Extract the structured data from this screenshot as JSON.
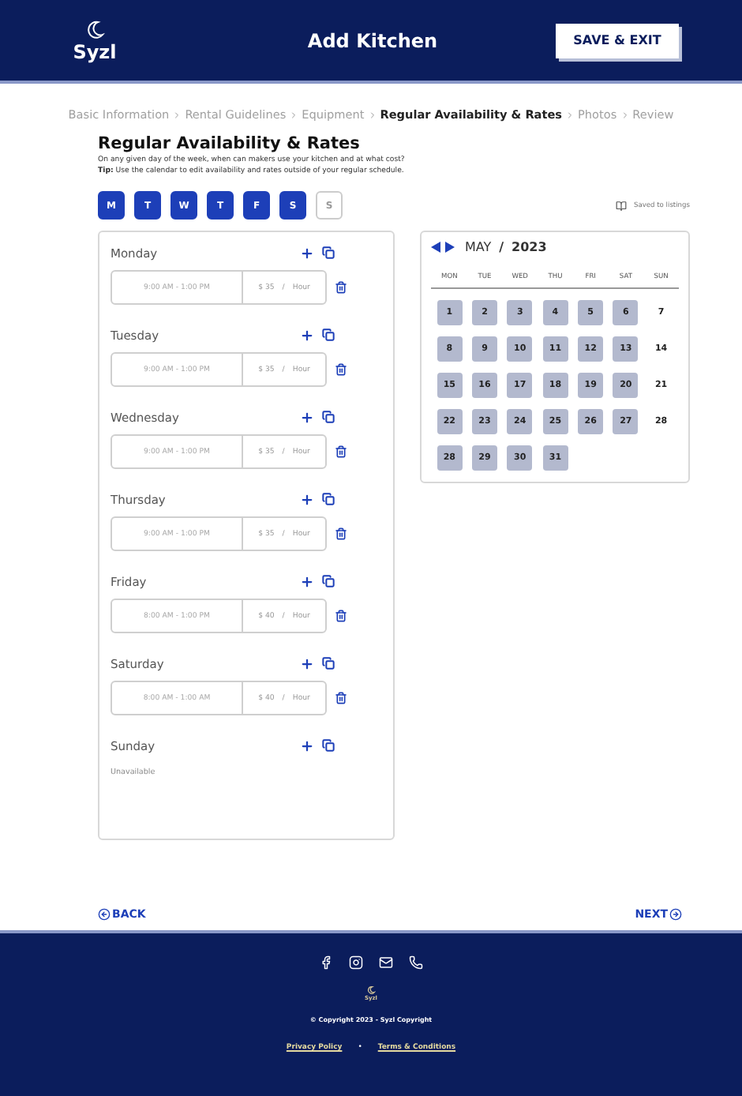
{
  "header": {
    "logo": "Syzl",
    "title": "Add Kitchen",
    "save_button": "SAVE & EXIT"
  },
  "breadcrumb": [
    {
      "label": "Basic Information",
      "selected": false
    },
    {
      "label": "Rental Guidelines",
      "selected": false
    },
    {
      "label": "Equipment",
      "selected": false
    },
    {
      "label": "Regular Availability & Rates",
      "selected": true
    },
    {
      "label": "Photos",
      "selected": false
    },
    {
      "label": "Review",
      "selected": false
    }
  ],
  "heading": "Regular Availability & Rates",
  "intro": "On any given day of the week, when can makers use your kitchen and at what cost?",
  "tip": "**Tip:** Use the calendar to edit availability and rates outside of your regular schedule.",
  "weekday_toggles": [
    {
      "label": "M",
      "selected": true
    },
    {
      "label": "T",
      "selected": true
    },
    {
      "label": "W",
      "selected": true
    },
    {
      "label": "T",
      "selected": true
    },
    {
      "label": "F",
      "selected": true
    },
    {
      "label": "S",
      "selected": true
    },
    {
      "label": "S",
      "selected": false
    }
  ],
  "saved_note": "Saved to listings",
  "schedule": [
    {
      "day": "Monday",
      "slots": [
        {
          "time": "9:00 AM - 1:00 PM",
          "price": "$ 35",
          "separator": "/",
          "unit": "Hour"
        }
      ]
    },
    {
      "day": "Tuesday",
      "slots": [
        {
          "time": "9:00 AM - 1:00 PM",
          "price": "$ 35",
          "separator": "/",
          "unit": "Hour"
        }
      ]
    },
    {
      "day": "Wednesday",
      "slots": [
        {
          "time": "9:00 AM - 1:00 PM",
          "price": "$ 35",
          "separator": "/",
          "unit": "Hour"
        }
      ]
    },
    {
      "day": "Thursday",
      "slots": [
        {
          "time": "9:00 AM - 1:00 PM",
          "price": "$ 35",
          "separator": "/",
          "unit": "Hour"
        }
      ]
    },
    {
      "day": "Friday",
      "slots": [
        {
          "time": "8:00 AM - 1:00 PM",
          "price": "$ 40",
          "separator": "/",
          "unit": "Hour"
        }
      ]
    },
    {
      "day": "Saturday",
      "slots": [
        {
          "time": "8:00 AM - 1:00 AM",
          "price": "$ 40",
          "separator": "/",
          "unit": "Hour"
        }
      ]
    },
    {
      "day": "Sunday",
      "note": "Unavailable"
    }
  ],
  "calendar": {
    "month": "MAY",
    "separator": "/",
    "year": "2023",
    "weekdays": [
      "MON",
      "TUE",
      "WED",
      "THU",
      "FRI",
      "SAT",
      "SUN"
    ],
    "days": [
      {
        "label": "1",
        "available": true
      },
      {
        "label": "2",
        "available": true
      },
      {
        "label": "3",
        "available": true
      },
      {
        "label": "4",
        "available": true
      },
      {
        "label": "5",
        "available": true
      },
      {
        "label": "6",
        "available": true
      },
      {
        "label": "7",
        "available": false
      },
      {
        "label": "8",
        "available": true
      },
      {
        "label": "9",
        "available": true
      },
      {
        "label": "10",
        "available": true
      },
      {
        "label": "11",
        "available": true
      },
      {
        "label": "12",
        "available": true
      },
      {
        "label": "13",
        "available": true
      },
      {
        "label": "14",
        "available": false
      },
      {
        "label": "15",
        "available": true
      },
      {
        "label": "16",
        "available": true
      },
      {
        "label": "17",
        "available": true
      },
      {
        "label": "18",
        "available": true
      },
      {
        "label": "19",
        "available": true
      },
      {
        "label": "20",
        "available": true
      },
      {
        "label": "21",
        "available": false
      },
      {
        "label": "22",
        "available": true
      },
      {
        "label": "23",
        "available": true
      },
      {
        "label": "24",
        "available": true
      },
      {
        "label": "25",
        "available": true
      },
      {
        "label": "26",
        "available": true
      },
      {
        "label": "27",
        "available": true
      },
      {
        "label": "28",
        "available": false
      },
      {
        "label": "28",
        "available": true
      },
      {
        "label": "29",
        "available": true
      },
      {
        "label": "30",
        "available": true
      },
      {
        "label": "31",
        "available": true
      }
    ]
  },
  "nav": {
    "back": "BACK",
    "next": "NEXT"
  },
  "footer": {
    "logo": "Syzl",
    "copyright": "© Copyright 2023 - Syzl Copyright",
    "links": [
      "Privacy Policy",
      "Terms & Conditions"
    ],
    "link_separator": "•"
  }
}
